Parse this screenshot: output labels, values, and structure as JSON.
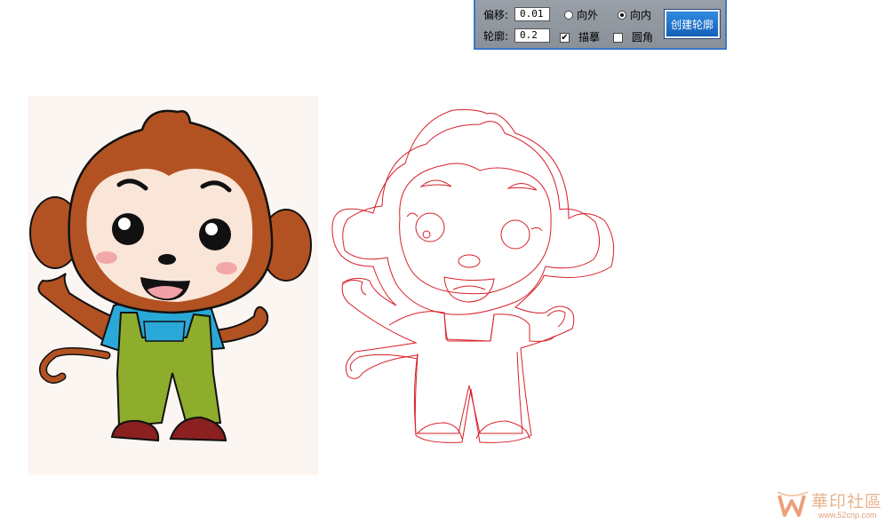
{
  "panel": {
    "offset_label": "偏移:",
    "offset_value": "0.01",
    "outline_label": "轮廓:",
    "outline_value": "0.2",
    "outward_label": "向外",
    "inward_label": "向内",
    "selected_direction": "inward",
    "stroke_label": "描摹",
    "stroke_checked": true,
    "round_label": "圆角",
    "round_checked": false,
    "create_button": "创建轮廓"
  },
  "watermark": {
    "text": "華印社區",
    "url": "www.52cnp.com"
  },
  "colors": {
    "panel_border": "#3a78c8",
    "button": "#1f72cc",
    "outline_stroke": "#d8202a",
    "monkey_fur": "#b25222",
    "monkey_face": "#fae6d8",
    "shirt": "#2aa8d8",
    "overalls": "#8ead2c",
    "shoes": "#8a2020"
  }
}
